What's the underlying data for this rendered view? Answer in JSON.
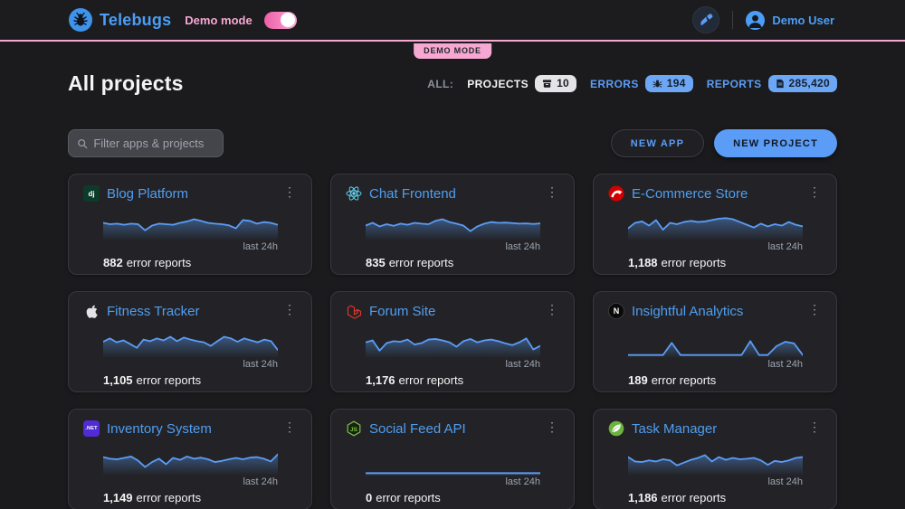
{
  "header": {
    "brand": "Telebugs",
    "demo_mode_label": "Demo mode",
    "demo_badge": "DEMO MODE",
    "user_name": "Demo User"
  },
  "page": {
    "title": "All projects",
    "stats": {
      "all_label": "ALL:",
      "projects_label": "PROJECTS",
      "projects_count": "10",
      "errors_label": "ERRORS",
      "errors_count": "194",
      "reports_label": "REPORTS",
      "reports_count": "285,420"
    },
    "filter_placeholder": "Filter apps & projects",
    "new_app_label": "NEW APP",
    "new_project_label": "NEW PROJECT"
  },
  "cards": {
    "last_label": "last 24h",
    "reports_suffix": "error reports"
  },
  "colors": {
    "accent_blue": "#5b9df6",
    "accent_pink": "#f6a8d3",
    "card_bg": "#232327",
    "page_bg": "#1b1b1e"
  },
  "projects": [
    {
      "name": "Blog Platform",
      "platform": "django",
      "icon_text": "dj",
      "count": "882",
      "spark": [
        55,
        50,
        52,
        48,
        52,
        50,
        28,
        45,
        52,
        50,
        48,
        55,
        60,
        68,
        62,
        55,
        52,
        50,
        46,
        35,
        65,
        62,
        52,
        58,
        55,
        48
      ]
    },
    {
      "name": "Chat Frontend",
      "platform": "react",
      "icon_text": "",
      "count": "835",
      "spark": [
        45,
        55,
        42,
        50,
        44,
        52,
        48,
        55,
        52,
        50,
        62,
        68,
        58,
        52,
        45,
        25,
        42,
        52,
        58,
        55,
        56,
        54,
        52,
        53,
        51,
        53
      ]
    },
    {
      "name": "E-Commerce Store",
      "platform": "rails",
      "icon_text": "",
      "count": "1,188",
      "spark": [
        35,
        55,
        60,
        45,
        65,
        30,
        55,
        50,
        58,
        62,
        58,
        60,
        65,
        70,
        72,
        68,
        58,
        48,
        38,
        52,
        42,
        50,
        45,
        58,
        48,
        42
      ]
    },
    {
      "name": "Fitness Tracker",
      "platform": "apple",
      "icon_text": "",
      "count": "1,105",
      "spark": [
        50,
        62,
        48,
        55,
        42,
        28,
        58,
        52,
        62,
        55,
        68,
        52,
        65,
        58,
        52,
        48,
        35,
        52,
        68,
        62,
        50,
        62,
        55,
        48,
        58,
        52,
        20
      ]
    },
    {
      "name": "Forum Site",
      "platform": "laravel",
      "icon_text": "",
      "count": "1,176",
      "spark": [
        48,
        55,
        18,
        45,
        52,
        50,
        58,
        40,
        45,
        58,
        60,
        55,
        48,
        32,
        52,
        60,
        48,
        55,
        58,
        52,
        44,
        38,
        48,
        62,
        22,
        35
      ]
    },
    {
      "name": "Insightful Analytics",
      "platform": "nextjs",
      "icon_text": "N",
      "count": "189",
      "spark": [
        2,
        2,
        2,
        2,
        2,
        46,
        2,
        2,
        2,
        2,
        2,
        2,
        2,
        2,
        52,
        2,
        2,
        34,
        50,
        44,
        2
      ]
    },
    {
      "name": "Inventory System",
      "platform": "dotnet",
      "icon_text": ".NET",
      "count": "1,149",
      "spark": [
        58,
        52,
        50,
        55,
        60,
        45,
        22,
        40,
        52,
        32,
        55,
        48,
        60,
        52,
        56,
        50,
        40,
        44,
        50,
        55,
        50,
        56,
        58,
        52,
        42,
        68
      ]
    },
    {
      "name": "Social Feed API",
      "platform": "nodejs",
      "icon_text": "JS",
      "count": "0",
      "spark": [
        0,
        0,
        0,
        0,
        0,
        0,
        0,
        0,
        0,
        0,
        0,
        0
      ]
    },
    {
      "name": "Task Manager",
      "platform": "spring",
      "icon_text": "",
      "count": "1,186",
      "spark": [
        58,
        42,
        40,
        46,
        42,
        50,
        46,
        28,
        38,
        48,
        55,
        65,
        42,
        58,
        48,
        55,
        50,
        52,
        55,
        46,
        30,
        44,
        40,
        46,
        55,
        58
      ]
    }
  ]
}
